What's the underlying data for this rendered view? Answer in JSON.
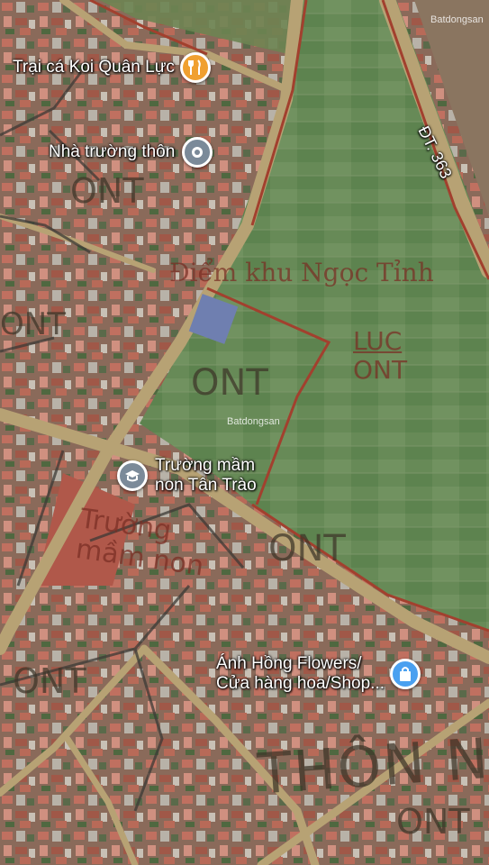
{
  "pois": [
    {
      "name": "Trại cá Koi Quân Lực",
      "icon": "restaurant-icon",
      "color": "#f0a030"
    },
    {
      "name": "Nhà trường thôn",
      "icon": "place-icon",
      "color": "#7b8a99"
    },
    {
      "name_line1": "Trường mầm",
      "name_line2": "non Tân Trào",
      "icon": "school-icon",
      "color": "#7b8a99"
    },
    {
      "name_line1": "Ánh Hồng Flowers/",
      "name_line2": "Cửa hàng hoa/Shop...",
      "icon": "shopping-bag-icon",
      "color": "#4aa0f0"
    }
  ],
  "road_label": "ĐT. 363",
  "overlay_labels": {
    "area_name": "Điểm khu Ngọc Tỉnh",
    "luc": "LUC",
    "ont_plot": "ONT",
    "ont": "ONT",
    "school_overlay": "Trường mầm non",
    "village": "THÔN NG"
  },
  "watermark": "Batdongsan"
}
